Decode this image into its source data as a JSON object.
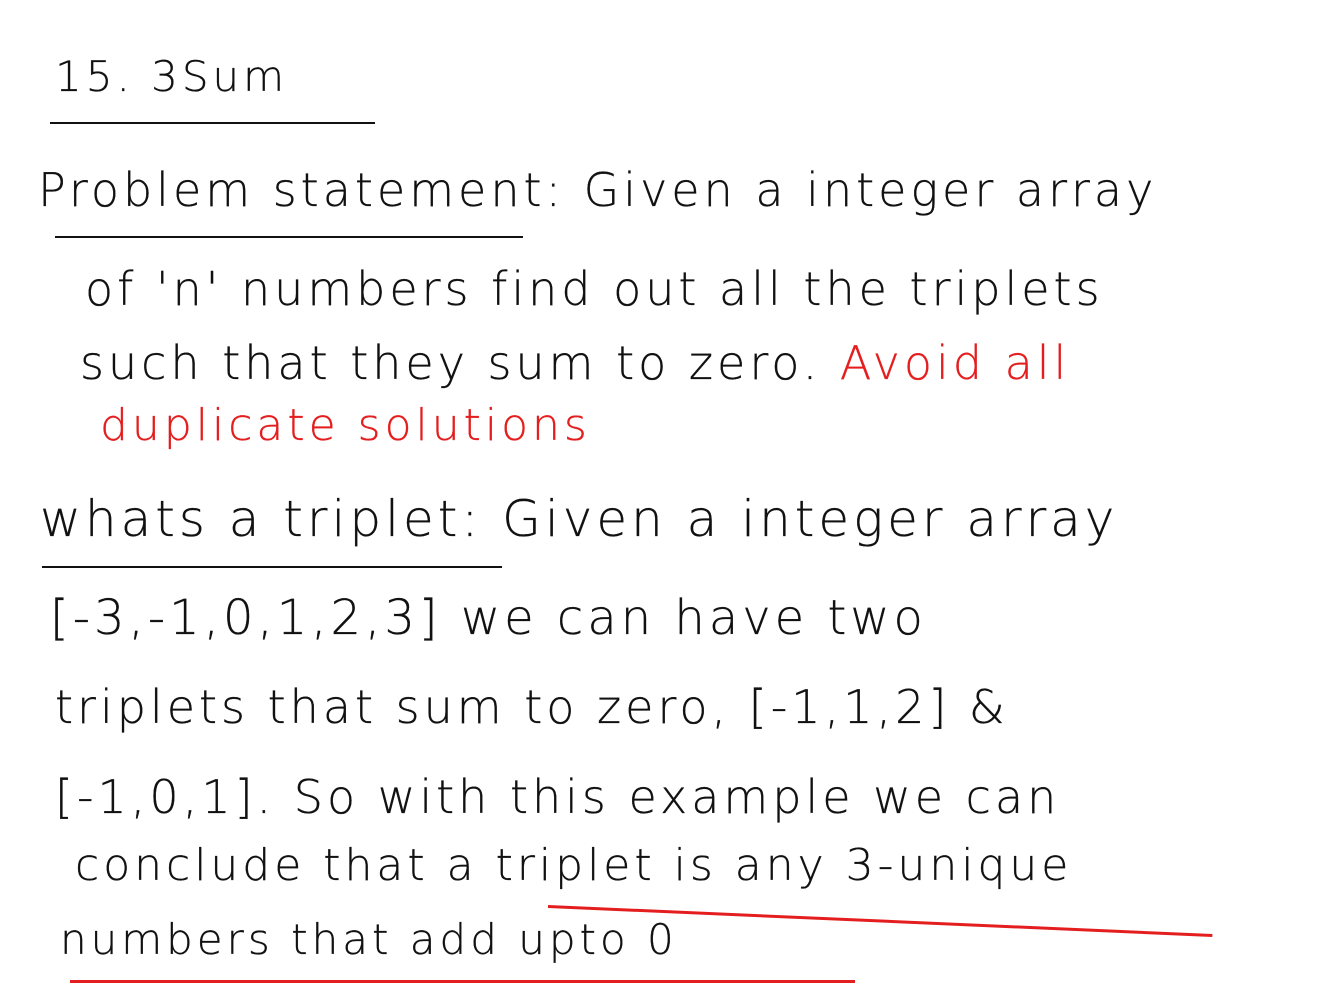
{
  "note": {
    "title": "15. 3Sum",
    "line1_label": "Problem statement:",
    "line1_rest": "Given a integer array",
    "line2": "of 'n' numbers find out all the triplets",
    "line3_black": "such that they sum to zero.",
    "line3_red": "Avoid all",
    "line4_red": "duplicate solutions",
    "line5_label": "whats a triplet:",
    "line5_rest": "Given a integer array",
    "line6": "[-3,-1,0,1,2,3]  we can have two",
    "line7": "triplets that sum to zero, [-1,1,2] &",
    "line8": "[-1,0,1]. So with this example we can",
    "line9": "conclude that a triplet is any 3-unique",
    "line10": "numbers that add upto 0",
    "colors": {
      "ink": "#111111",
      "red": "#e41e1e",
      "background": "#ffffff"
    }
  }
}
